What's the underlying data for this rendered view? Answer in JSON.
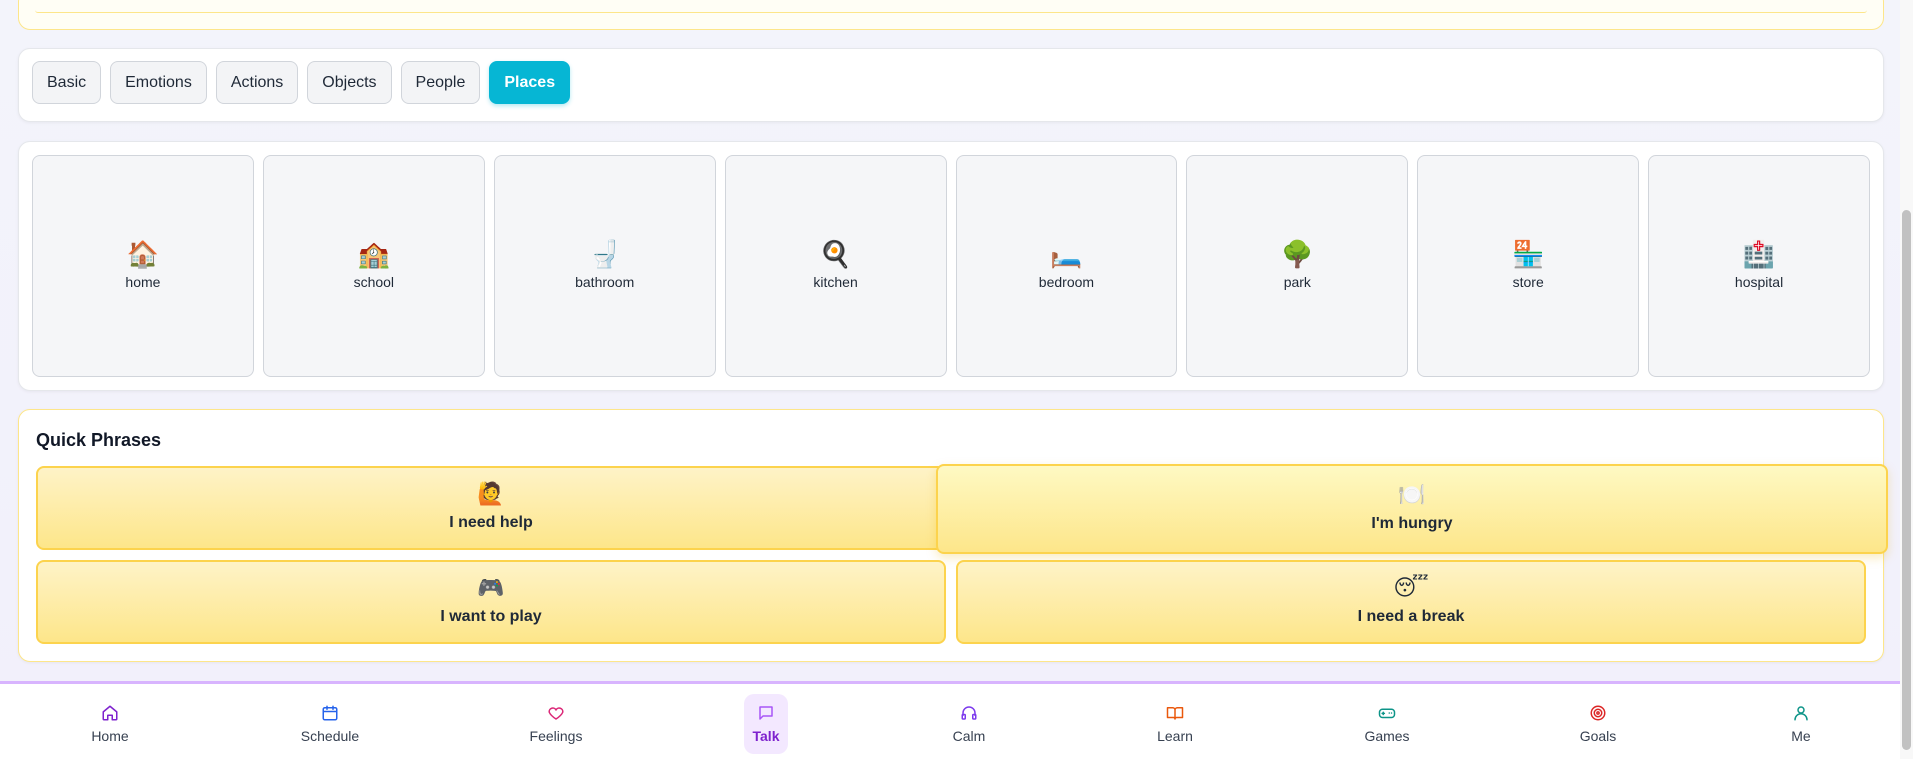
{
  "categories": {
    "tabs": [
      {
        "label": "Basic",
        "active": false
      },
      {
        "label": "Emotions",
        "active": false
      },
      {
        "label": "Actions",
        "active": false
      },
      {
        "label": "Objects",
        "active": false
      },
      {
        "label": "People",
        "active": false
      },
      {
        "label": "Places",
        "active": true
      }
    ]
  },
  "places": [
    {
      "icon": "🏠",
      "label": "home"
    },
    {
      "icon": "🏫",
      "label": "school"
    },
    {
      "icon": "🚽",
      "label": "bathroom"
    },
    {
      "icon": "🍳",
      "label": "kitchen"
    },
    {
      "icon": "🛏️",
      "label": "bedroom"
    },
    {
      "icon": "🌳",
      "label": "park"
    },
    {
      "icon": "🏪",
      "label": "store"
    },
    {
      "icon": "🏥",
      "label": "hospital"
    }
  ],
  "quick_phrases": {
    "title": "Quick Phrases",
    "items": [
      {
        "icon": "🙋",
        "label": "I need help"
      },
      {
        "icon": "🍽️",
        "label": "I'm hungry"
      },
      {
        "icon": "🎮",
        "label": "I want to play"
      },
      {
        "icon": "😴",
        "label": "I need a break"
      }
    ]
  },
  "nav": {
    "items": [
      {
        "label": "Home",
        "icon": "house-icon",
        "color": "#7e22ce"
      },
      {
        "label": "Schedule",
        "icon": "calendar-icon",
        "color": "#2563eb"
      },
      {
        "label": "Feelings",
        "icon": "heart-icon",
        "color": "#db2777"
      },
      {
        "label": "Talk",
        "icon": "message-icon",
        "color": "#a855f7",
        "active": true
      },
      {
        "label": "Calm",
        "icon": "headphones-icon",
        "color": "#7c3aed"
      },
      {
        "label": "Learn",
        "icon": "book-icon",
        "color": "#ea580c"
      },
      {
        "label": "Games",
        "icon": "gamepad-icon",
        "color": "#0d9488"
      },
      {
        "label": "Goals",
        "icon": "target-icon",
        "color": "#dc2626"
      },
      {
        "label": "Me",
        "icon": "user-icon",
        "color": "#0d9488"
      }
    ]
  },
  "colors": {
    "accent": "#06b6d4",
    "phrase_bg": "#fde68a",
    "nav_active": "#f3e8ff"
  }
}
